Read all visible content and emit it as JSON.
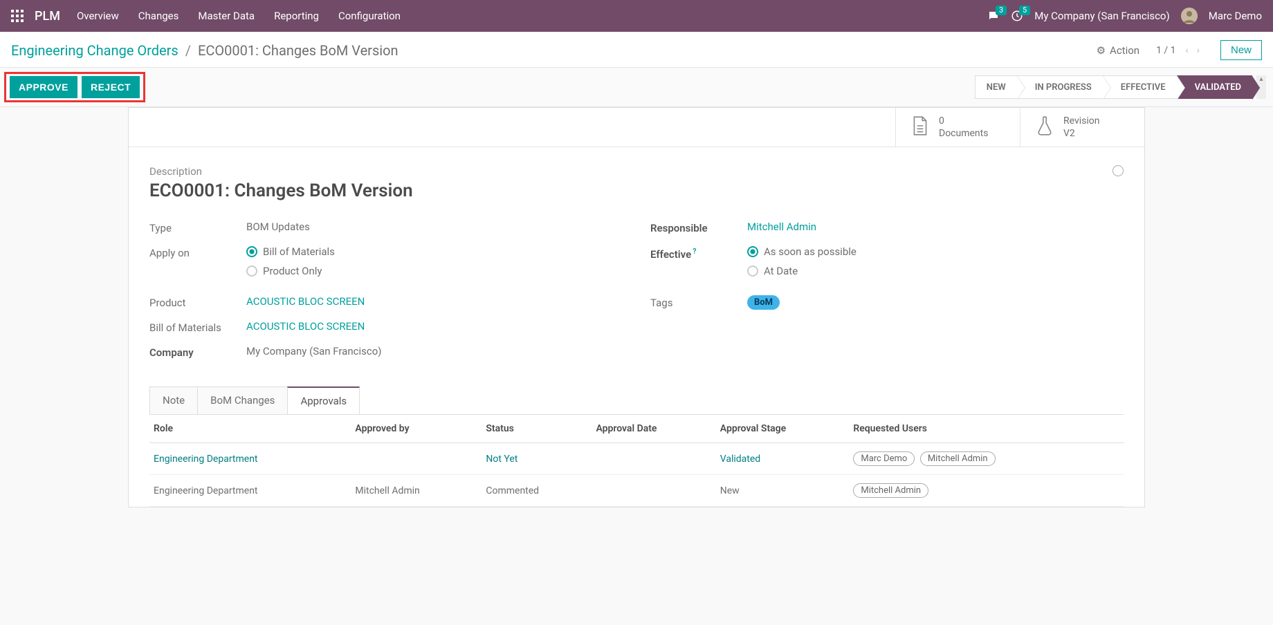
{
  "topbar": {
    "app_name": "PLM",
    "menu": [
      "Overview",
      "Changes",
      "Master Data",
      "Reporting",
      "Configuration"
    ],
    "chat_count": "3",
    "clock_count": "5",
    "company": "My Company (San Francisco)",
    "user": "Marc Demo"
  },
  "breadcrumb": {
    "root": "Engineering Change Orders",
    "sep": "/",
    "current": "ECO0001: Changes BoM Version"
  },
  "header_actions": {
    "action_label": "Action",
    "pager": "1 / 1",
    "new_btn": "New"
  },
  "buttons": {
    "approve": "APPROVE",
    "reject": "REJECT"
  },
  "stages": [
    "NEW",
    "IN PROGRESS",
    "EFFECTIVE",
    "VALIDATED"
  ],
  "active_stage": "VALIDATED",
  "stat_buttons": {
    "docs_count": "0",
    "docs_label": "Documents",
    "rev_label": "Revision",
    "rev_val": "V2"
  },
  "record": {
    "desc_label": "Description",
    "title": "ECO0001: Changes BoM Version",
    "labels": {
      "type": "Type",
      "apply_on": "Apply on",
      "product": "Product",
      "bom": "Bill of Materials",
      "company": "Company",
      "responsible": "Responsible",
      "effective": "Effective",
      "tags": "Tags"
    },
    "type": "BOM Updates",
    "apply_on": {
      "opt1": "Bill of Materials",
      "opt2": "Product Only"
    },
    "product": "ACOUSTIC BLOC SCREEN",
    "bom": "ACOUSTIC BLOC SCREEN",
    "company": "My Company (San Francisco)",
    "responsible": "Mitchell Admin",
    "effective": {
      "opt1": "As soon as possible",
      "opt2": "At Date"
    },
    "tag": "BoM"
  },
  "tabs": [
    "Note",
    "BoM Changes",
    "Approvals"
  ],
  "active_tab": "Approvals",
  "approvals": {
    "headers": [
      "Role",
      "Approved by",
      "Status",
      "Approval Date",
      "Approval Stage",
      "Requested Users"
    ],
    "rows": [
      {
        "role": "Engineering Department",
        "role_link": true,
        "approved_by": "",
        "status": "Not Yet",
        "status_link": true,
        "date": "",
        "stage": "Validated",
        "stage_link": true,
        "users": [
          "Marc Demo",
          "Mitchell Admin"
        ]
      },
      {
        "role": "Engineering Department",
        "role_link": false,
        "approved_by": "Mitchell Admin",
        "status": "Commented",
        "status_link": false,
        "date": "",
        "stage": "New",
        "stage_link": false,
        "users": [
          "Mitchell Admin"
        ]
      }
    ]
  }
}
